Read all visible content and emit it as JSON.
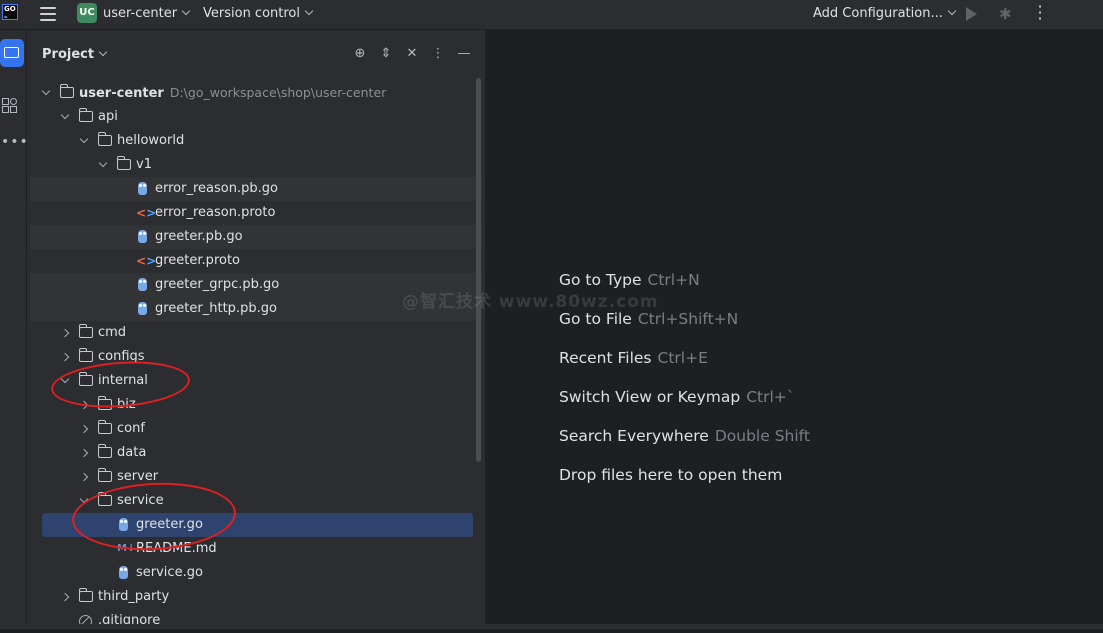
{
  "titlebar": {
    "project_badge": "UC",
    "project_name": "user-center",
    "vcs_label": "Version control",
    "run_config_label": "Add Configuration..."
  },
  "project_panel": {
    "title": "Project"
  },
  "tree": [
    {
      "label": "user-center",
      "path": "D:\\go_workspace\\shop\\user-center",
      "type": "folder",
      "expanded": true,
      "depth": 0,
      "bold": true
    },
    {
      "label": "api",
      "type": "folder",
      "expanded": true,
      "depth": 1
    },
    {
      "label": "helloworld",
      "type": "folder",
      "expanded": true,
      "depth": 2
    },
    {
      "label": "v1",
      "type": "folder",
      "expanded": true,
      "depth": 3
    },
    {
      "label": "error_reason.pb.go",
      "type": "go",
      "depth": 4,
      "highlight": true
    },
    {
      "label": "error_reason.proto",
      "type": "proto",
      "depth": 4
    },
    {
      "label": "greeter.pb.go",
      "type": "go",
      "depth": 4,
      "highlight": true
    },
    {
      "label": "greeter.proto",
      "type": "proto",
      "depth": 4
    },
    {
      "label": "greeter_grpc.pb.go",
      "type": "go",
      "depth": 4,
      "highlight": true
    },
    {
      "label": "greeter_http.pb.go",
      "type": "go",
      "depth": 4,
      "highlight": true
    },
    {
      "label": "cmd",
      "type": "folder",
      "expanded": false,
      "depth": 1
    },
    {
      "label": "configs",
      "type": "folder",
      "expanded": false,
      "depth": 1
    },
    {
      "label": "internal",
      "type": "folder",
      "expanded": true,
      "depth": 1
    },
    {
      "label": "biz",
      "type": "folder",
      "expanded": false,
      "depth": 2
    },
    {
      "label": "conf",
      "type": "folder",
      "expanded": false,
      "depth": 2
    },
    {
      "label": "data",
      "type": "folder",
      "expanded": false,
      "depth": 2
    },
    {
      "label": "server",
      "type": "folder",
      "expanded": false,
      "depth": 2
    },
    {
      "label": "service",
      "type": "folder",
      "expanded": true,
      "depth": 2
    },
    {
      "label": "greeter.go",
      "type": "go",
      "depth": 3,
      "selected": true
    },
    {
      "label": "README.md",
      "type": "md",
      "depth": 3
    },
    {
      "label": "service.go",
      "type": "go",
      "depth": 3
    },
    {
      "label": "third_party",
      "type": "folder",
      "expanded": false,
      "depth": 1
    },
    {
      "label": ".gitignore",
      "type": "ignore",
      "depth": 1
    }
  ],
  "editor_hints": [
    {
      "action": "Go to Type",
      "shortcut": "Ctrl+N"
    },
    {
      "action": "Go to File",
      "shortcut": "Ctrl+Shift+N"
    },
    {
      "action": "Recent Files",
      "shortcut": "Ctrl+E"
    },
    {
      "action": "Switch View or Keymap",
      "shortcut": "Ctrl+`"
    },
    {
      "action": "Search Everywhere",
      "shortcut": "Double Shift"
    },
    {
      "action": "Drop files here to open them",
      "shortcut": ""
    }
  ],
  "watermark": "@智汇技术 www.80wz.com",
  "colors": {
    "background": "#1e1f22",
    "panel": "#2b2d30",
    "accent": "#3574f0",
    "selection": "#2e436e",
    "annotation": "#e02020"
  }
}
